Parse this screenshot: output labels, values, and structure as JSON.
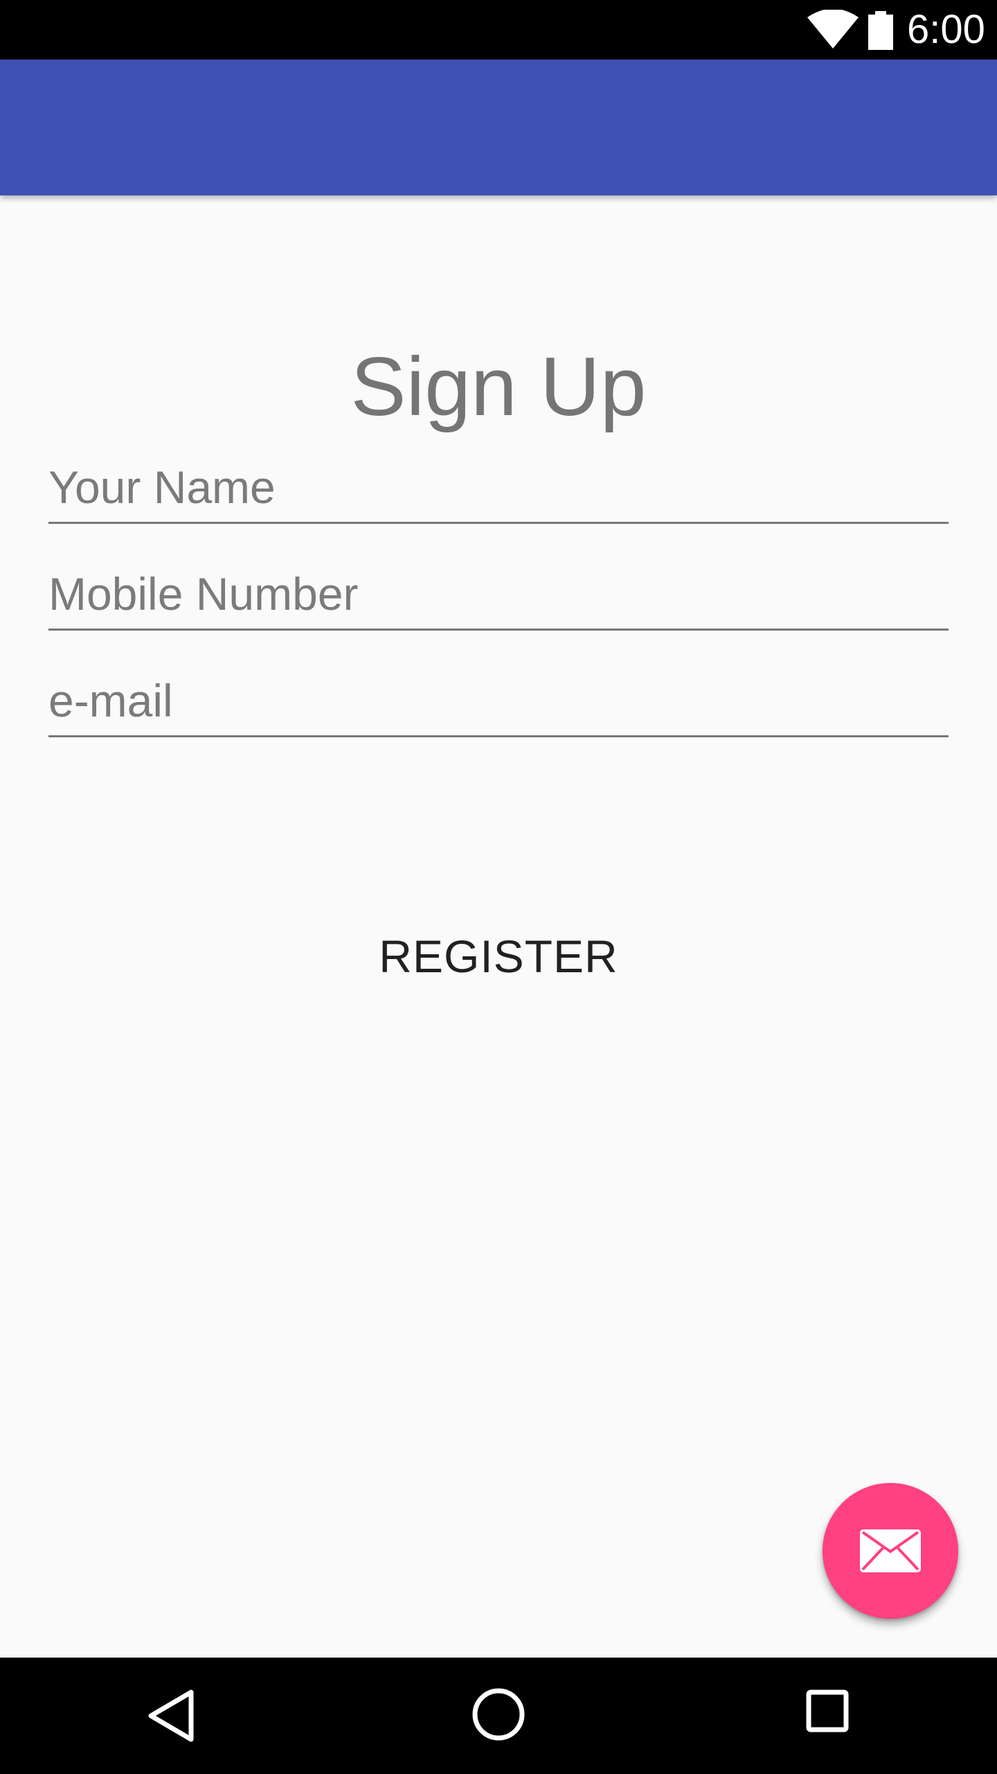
{
  "status_bar": {
    "time": "6:00",
    "icons": [
      "wifi-icon",
      "battery-icon"
    ]
  },
  "app_bar": {
    "color": "#3f51b5"
  },
  "form": {
    "title": "Sign Up",
    "name_placeholder": "Your Name",
    "mobile_placeholder": "Mobile Number",
    "email_placeholder": "e-mail",
    "register_label": "REGISTER"
  },
  "fab": {
    "icon": "mail-icon",
    "color": "#ff4081"
  },
  "nav_bar": {
    "icons": [
      "back-icon",
      "home-icon",
      "recents-icon"
    ]
  }
}
